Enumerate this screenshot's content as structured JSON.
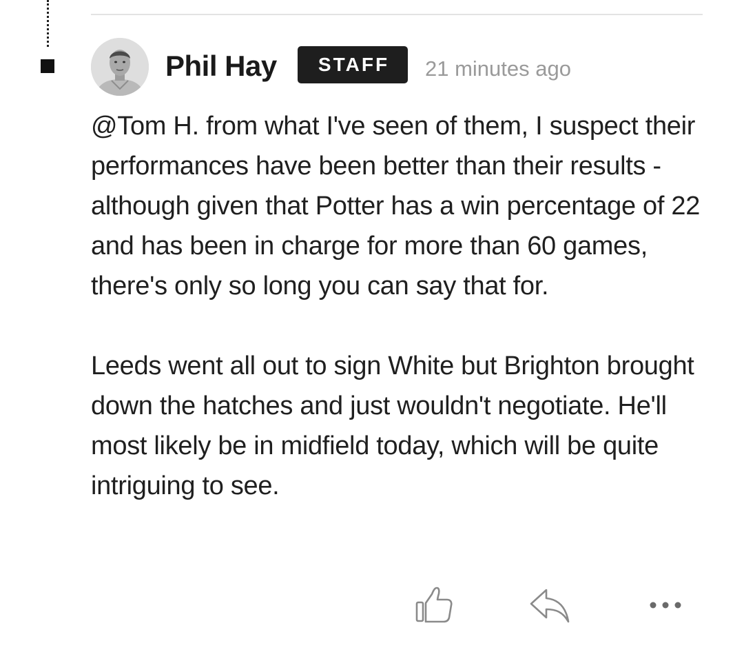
{
  "comment": {
    "author": "Phil Hay",
    "badge": "STAFF",
    "timestamp": "21 minutes ago",
    "paragraphs": [
      "@Tom H. from what I've seen of them, I suspect their performances have been better than their results - although given that Potter has a win percentage of 22 and has been in charge for more than 60 games, there's only so long you can say that for.",
      "Leeds went all out to sign White but Brighton brought down the hatches and just wouldn't negotiate. He'll most likely be in midfield today, which will be quite intriguing to see."
    ],
    "actions": {
      "like_icon": "thumbs-up-icon",
      "reply_icon": "reply-arrow-icon",
      "more_icon": "more-horizontal-icon"
    }
  },
  "colors": {
    "badge_background": "#1e1e1e",
    "timestamp": "#9a9a9a",
    "icon": "#8a8a8a"
  }
}
